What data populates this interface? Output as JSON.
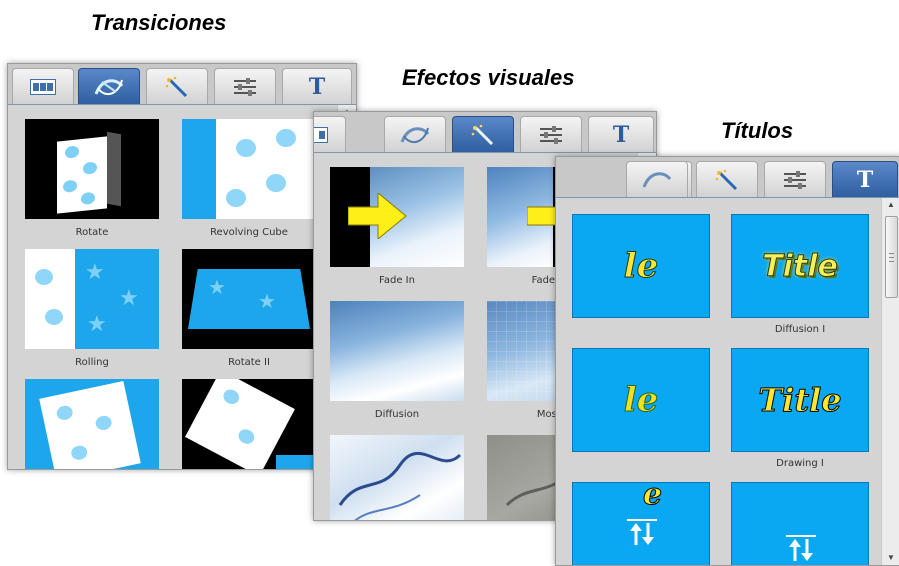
{
  "headings": {
    "transitions": "Transiciones",
    "effects": "Efectos visuales",
    "titles": "Títulos"
  },
  "tab_icons": [
    "filmstrip-icon",
    "transition-swirl-icon",
    "magic-wand-icon",
    "sliders-icon",
    "title-t-icon"
  ],
  "tab_t_label": "T",
  "transitions_panel": {
    "active_tab": "transition-swirl",
    "items": [
      {
        "label": "Rotate"
      },
      {
        "label": "Revolving Cube"
      },
      {
        "label": "Rolling"
      },
      {
        "label": "Rotate II"
      },
      {
        "label": ""
      },
      {
        "label": ""
      }
    ]
  },
  "effects_panel": {
    "active_tab": "magic-wand",
    "items": [
      {
        "label": "Fade In"
      },
      {
        "label": "Fade Out"
      },
      {
        "label": "Diffusion"
      },
      {
        "label": "Mosaic"
      },
      {
        "label": ""
      },
      {
        "label": ""
      }
    ]
  },
  "titles_panel": {
    "active_tab": "title-t",
    "items": [
      {
        "label": "",
        "text": "le"
      },
      {
        "label": "Diffusion I",
        "text": "Title"
      },
      {
        "label": "",
        "text": "le"
      },
      {
        "label": "Drawing I",
        "text": "Title"
      },
      {
        "label": "",
        "text": "e"
      },
      {
        "label": "",
        "text": ""
      }
    ]
  },
  "colors": {
    "accent_blue": "#1ea6ec",
    "title_blue": "#0aa7f2",
    "active_tab": "#3b6eb0",
    "panel_bg": "#d4d4d4"
  }
}
